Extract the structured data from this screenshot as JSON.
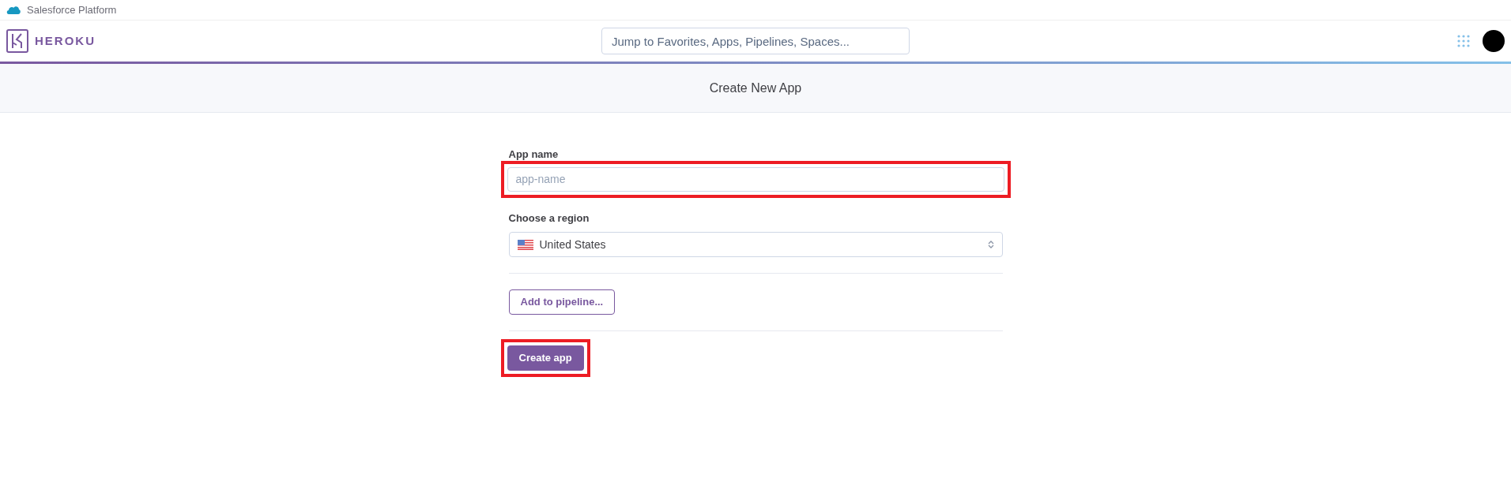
{
  "platform_bar": {
    "label": "Salesforce Platform"
  },
  "navbar": {
    "brand": "HEROKU",
    "search": {
      "placeholder": "Jump to Favorites, Apps, Pipelines, Spaces..."
    }
  },
  "page_header": {
    "title": "Create New App"
  },
  "form": {
    "app_name": {
      "label": "App name",
      "placeholder": "app-name",
      "highlighted": true
    },
    "region": {
      "label": "Choose a region",
      "value": "United States"
    },
    "pipeline_button": {
      "label": "Add to pipeline..."
    },
    "create_button": {
      "label": "Create app",
      "highlighted": true
    }
  }
}
